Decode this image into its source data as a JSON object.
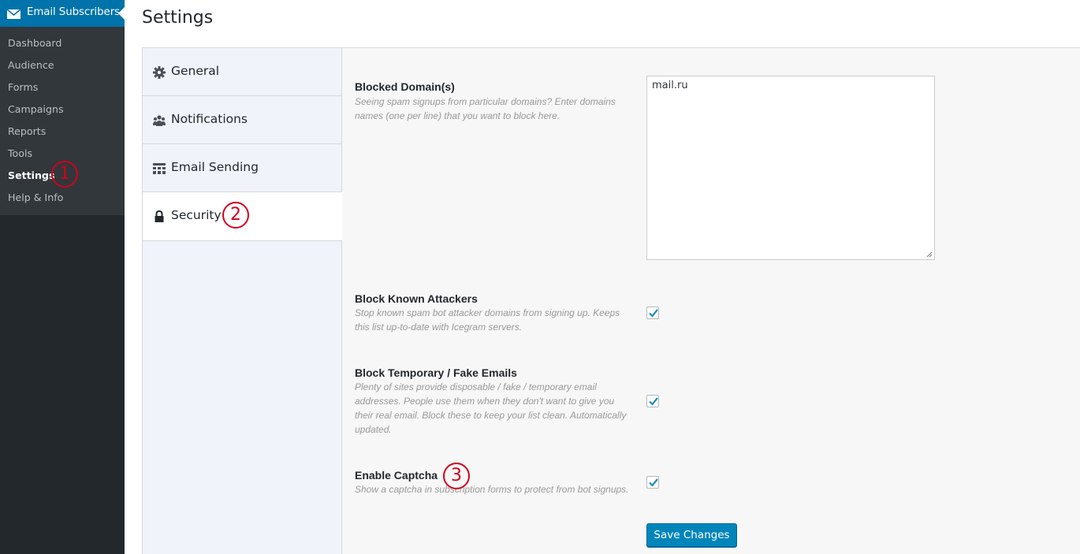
{
  "sidebar": {
    "plugin_title": "Email Subscribers",
    "items": [
      {
        "label": "Dashboard"
      },
      {
        "label": "Audience"
      },
      {
        "label": "Forms"
      },
      {
        "label": "Campaigns"
      },
      {
        "label": "Reports"
      },
      {
        "label": "Tools"
      },
      {
        "label": "Settings",
        "current": true
      },
      {
        "label": "Help & Info"
      }
    ]
  },
  "page": {
    "title": "Settings"
  },
  "tabs": [
    {
      "label": "General",
      "icon": "gear-icon"
    },
    {
      "label": "Notifications",
      "icon": "users-icon"
    },
    {
      "label": "Email Sending",
      "icon": "grid-icon"
    },
    {
      "label": "Security",
      "icon": "lock-icon",
      "active": true
    }
  ],
  "security": {
    "blocked_domains": {
      "label": "Blocked Domain(s)",
      "desc_lines": [
        "Seeing spam signups from particular domains? Enter domains",
        "names (one per line) that you want to block here."
      ],
      "value": "mail.ru"
    },
    "block_known_attackers": {
      "label": "Block Known Attackers",
      "desc_lines": [
        "Stop known spam bot attacker domains from signing up. Keeps",
        "this list up-to-date with Icegram servers."
      ],
      "checked": true
    },
    "block_temp_emails": {
      "label": "Block Temporary / Fake Emails",
      "desc_lines": [
        "Plenty of sites provide disposable / fake / temporary email",
        "addresses. People use them when they don't want to give you",
        "their real email. Block these to keep your list clean. Automatically",
        "updated."
      ],
      "checked": true
    },
    "enable_captcha": {
      "label": "Enable Captcha",
      "desc_lines": [
        "Show a captcha in subscription forms to protect from bot signups."
      ],
      "checked": true
    }
  },
  "save_button": "Save Changes",
  "annotations": [
    "1",
    "2",
    "3"
  ],
  "colors": {
    "accent": "#0073aa",
    "button": "#0085ba",
    "annotation": "#d0021b"
  }
}
